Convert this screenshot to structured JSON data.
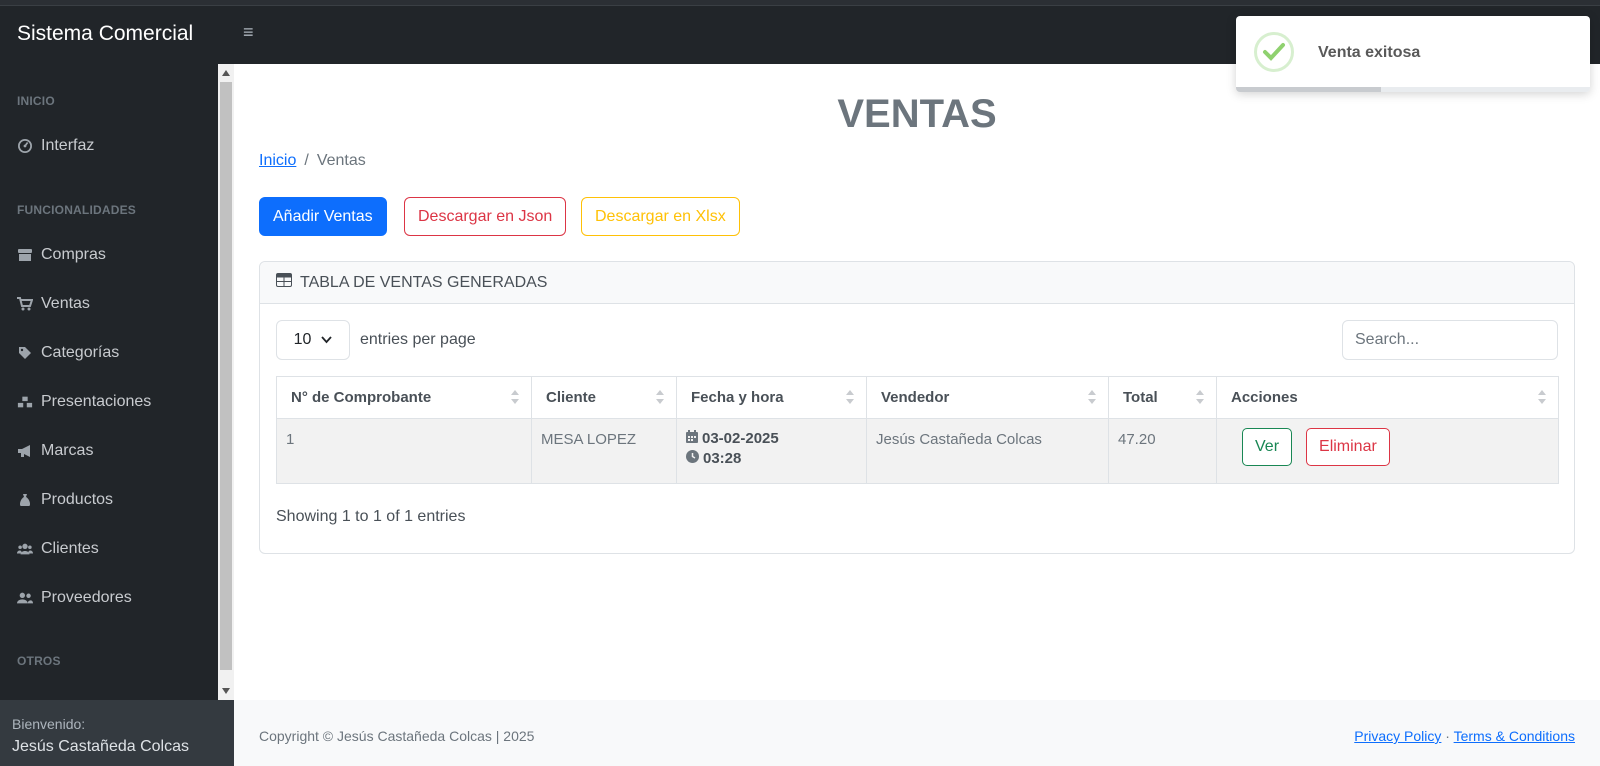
{
  "app": {
    "brand": "Sistema Comercial",
    "menu_toggle": "≡"
  },
  "sidebar": {
    "sections": [
      {
        "heading": "INICIO"
      },
      {
        "heading": "FUNCIONALIDADES"
      },
      {
        "heading": "OTROS"
      }
    ],
    "items": [
      {
        "label": "Interfaz",
        "icon": "gauge-icon"
      },
      {
        "label": "Compras",
        "icon": "store-icon"
      },
      {
        "label": "Ventas",
        "icon": "cart-icon"
      },
      {
        "label": "Categorías",
        "icon": "tag-icon"
      },
      {
        "label": "Presentaciones",
        "icon": "boxes-icon"
      },
      {
        "label": "Marcas",
        "icon": "bullhorn-icon"
      },
      {
        "label": "Productos",
        "icon": "money-bag-icon"
      },
      {
        "label": "Clientes",
        "icon": "users-icon"
      },
      {
        "label": "Proveedores",
        "icon": "user-group-icon"
      }
    ],
    "footer": {
      "welcome": "Bienvenido:",
      "user": "Jesús Castañeda Colcas"
    }
  },
  "main": {
    "title": "VENTAS",
    "breadcrumb": {
      "home": "Inicio",
      "separator": "/",
      "current": "Ventas"
    },
    "buttons": {
      "add": "Añadir Ventas",
      "json": "Descargar en Json",
      "xlsx": "Descargar en Xlsx"
    },
    "card": {
      "header": "TABLA DE VENTAS GENERADAS",
      "entries_value": "10",
      "entries_label": "entries per page",
      "search_placeholder": "Search...",
      "columns": [
        "N° de Comprobante",
        "Cliente",
        "Fecha y hora",
        "Vendedor",
        "Total",
        "Acciones"
      ],
      "rows": [
        {
          "numero": "1",
          "cliente": "MESA LOPEZ",
          "fecha": "03-02-2025",
          "hora": "03:28",
          "vendedor": "Jesús Castañeda Colcas",
          "total": "47.20",
          "ver": "Ver",
          "eliminar": "Eliminar"
        }
      ],
      "showing": "Showing 1 to 1 of 1 entries"
    }
  },
  "footer": {
    "copyright": "Copyright © Jesús Castañeda Colcas | 2025",
    "privacy": "Privacy Policy",
    "dot": "·",
    "terms": "Terms & Conditions"
  },
  "toast": {
    "message": "Venta exitosa",
    "icon": "check-circle-icon",
    "progress_remaining": 0.41
  },
  "colors": {
    "primary": "#0d6efd",
    "danger": "#dc3545",
    "warning": "#ffc107",
    "success": "#198754",
    "sidebar_bg": "#212529"
  }
}
